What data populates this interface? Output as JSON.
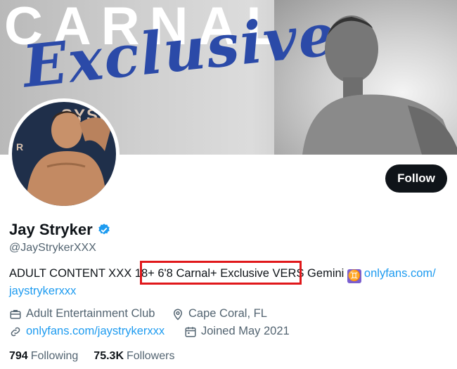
{
  "banner": {
    "brand_text": "CARNAL",
    "script_text": "Exclusive"
  },
  "profile": {
    "name": "Jay Stryker",
    "handle": "@JayStrykerXXX",
    "bio_part1": "ADULT CONTENT XXX 18+ 6'8 Carnal+ Exclusive VERS Gemini ",
    "bio_link": "onlyfans.com/",
    "bio_link2": "jaystrykerxxx",
    "category": "Adult Entertainment Club",
    "location": "Cape Coral, FL",
    "website": "onlyfans.com/jaystrykerxxx",
    "joined": "Joined May 2021"
  },
  "follow_button": {
    "label": "Follow"
  },
  "stats": {
    "following_count": "794",
    "following_label": "Following",
    "followers_count": "75.3K",
    "followers_label": "Followers"
  },
  "avatar": {
    "sign_text": "SYSC",
    "sign_text2": "R"
  },
  "icons": [
    "verified-badge-icon",
    "gemini-icon",
    "briefcase-icon",
    "location-pin-icon",
    "link-icon",
    "calendar-icon"
  ],
  "colors": {
    "accent": "#1d9bf0",
    "highlight_box": "#e0181b",
    "text": "#0f1419",
    "muted": "#536471"
  }
}
